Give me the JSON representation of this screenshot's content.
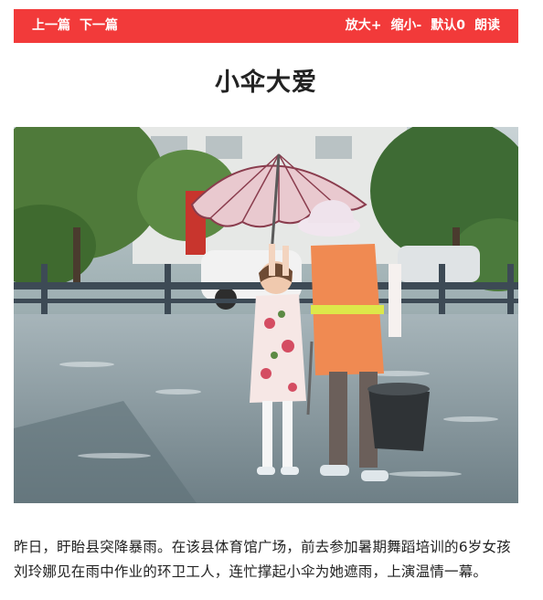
{
  "toolbar": {
    "prev_label": "上一篇",
    "next_label": "下一篇",
    "zoom_in_label": "放大+",
    "zoom_out_label": "缩小-",
    "default_label": "默认0",
    "read_aloud_label": "朗读"
  },
  "article": {
    "title": "小伞大爱",
    "paragraph": "昨日，盱眙县突降暴雨。在该县体育馆广场，前去参加暑期舞蹈培训的6岁女孩刘玲娜见在雨中作业的环卫工人，连忙撑起小伞为她遮雨，上演温情一幕。"
  },
  "colors": {
    "accent": "#f23a3a",
    "text": "#222222"
  }
}
